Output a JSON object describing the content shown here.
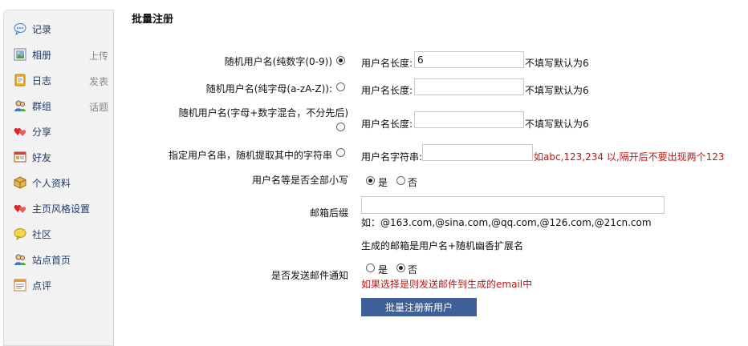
{
  "sidebar": {
    "items": [
      {
        "label": "记录",
        "sub": ""
      },
      {
        "label": "相册",
        "sub": "上传"
      },
      {
        "label": "日志",
        "sub": "发表"
      },
      {
        "label": "群组",
        "sub": "话题"
      },
      {
        "label": "分享",
        "sub": ""
      },
      {
        "label": "好友",
        "sub": ""
      },
      {
        "label": "个人资料",
        "sub": ""
      },
      {
        "label": "主页风格设置",
        "sub": ""
      },
      {
        "label": "社区",
        "sub": ""
      },
      {
        "label": "站点首页",
        "sub": ""
      },
      {
        "label": "点评",
        "sub": ""
      }
    ]
  },
  "page": {
    "title": "批量注册"
  },
  "form": {
    "opt1": {
      "label": "随机用户名(纯数字(0-9))",
      "len_label": "用户名长度:",
      "len_value": "6",
      "hint": "不填写默认为6"
    },
    "opt2": {
      "label": "随机用户名(纯字母(a-zA-Z)):",
      "len_label": "用户名长度:",
      "len_value": "",
      "hint": "不填写默认为6"
    },
    "opt3": {
      "label": "随机用户名(字母+数字混合，不分先后)",
      "len_label": "用户名长度:",
      "len_value": "",
      "hint": "不填写默认为6"
    },
    "opt4": {
      "label": "指定用户名串，随机提取其中的字符串",
      "str_label": "用户名字符串:",
      "str_value": "",
      "hint": "如abc,123,234 以,隔开后不要出现两个123"
    },
    "lowercase": {
      "label": "用户名等是否全部小写",
      "yes": "是",
      "no": "否"
    },
    "email": {
      "label": "邮箱后缀",
      "value": "",
      "example": "如：@163.com,@sina.com,@qq.com,@126.com,@21cn.com",
      "note": "生成的邮箱是用户名+随机幽香扩展名"
    },
    "notify": {
      "label": "是否发送邮件通知",
      "yes": "是",
      "no": "否",
      "hint": "如果选择是则发送邮件到生成的email中"
    },
    "submit_label": "批量注册新用户"
  }
}
